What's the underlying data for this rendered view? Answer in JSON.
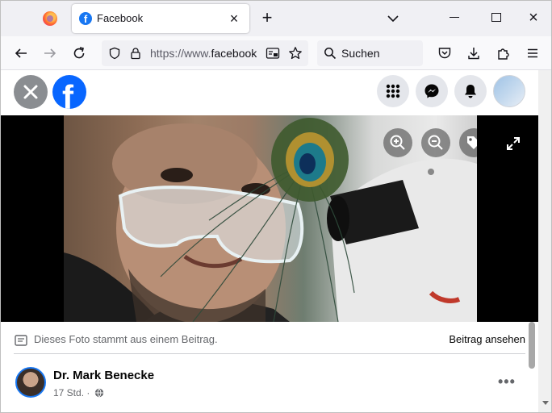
{
  "browser": {
    "tab_title": "Facebook",
    "tab_favicon": "f",
    "url_prefix": "https://www.",
    "url_domain": "facebook",
    "search_placeholder": "Suchen"
  },
  "viewer": {
    "info_text": "Dieses Foto stammt aus einem Beitrag.",
    "view_post_label": "Beitrag ansehen",
    "author_name": "Dr. Mark Benecke",
    "post_time": "17 Std. ·",
    "more_label": "•••",
    "fb_logo_letter": "f"
  },
  "colors": {
    "facebook_blue": "#0866ff",
    "avatar_ring": "#1877f2",
    "secondary_text": "#65676b"
  }
}
